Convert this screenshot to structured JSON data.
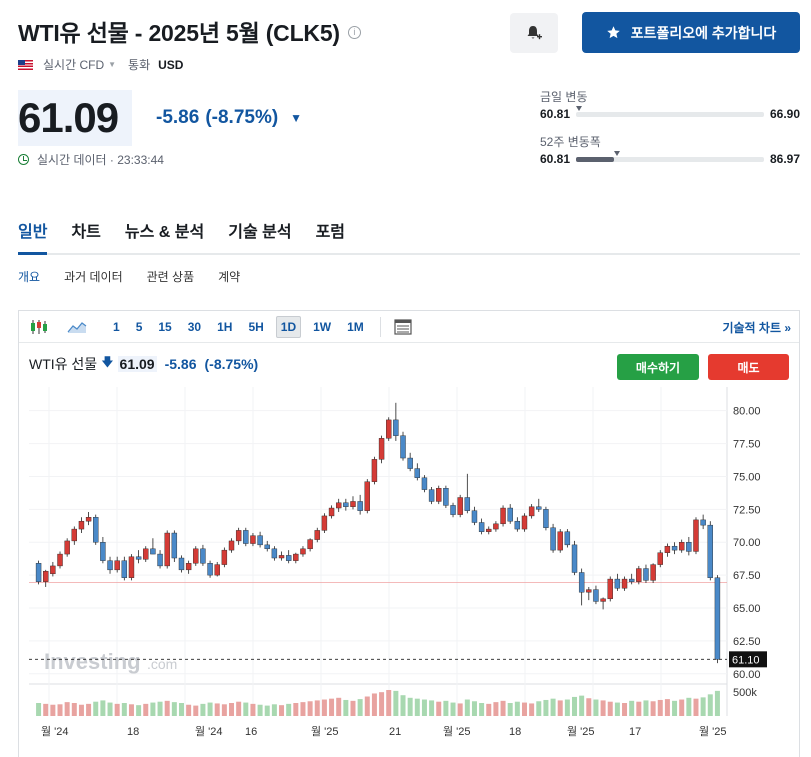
{
  "header": {
    "title": "WTI유 선물 - 2025년 5월 (CLK5)",
    "market_type": "실시간 CFD",
    "currency_label": "통화",
    "currency": "USD",
    "portfolio_label": "포트폴리오에 추가합니다"
  },
  "quote": {
    "price": "61.09",
    "change": "-5.86",
    "change_pct": "(-8.75%)",
    "realtime_label": "실시간 데이터 · 23:33:44"
  },
  "ranges": {
    "day": {
      "label": "금일 변동",
      "low": "60.81",
      "high": "66.90",
      "position": 0.0
    },
    "week52": {
      "label": "52주 변동폭",
      "low": "60.81",
      "high": "86.97",
      "position": 0.2
    }
  },
  "tabs": [
    "일반",
    "차트",
    "뉴스 & 분석",
    "기술 분석",
    "포럼"
  ],
  "subtabs": [
    "개요",
    "과거 데이터",
    "관련 상품",
    "계약"
  ],
  "toolbar": {
    "timeframes": [
      "1",
      "5",
      "15",
      "30",
      "1H",
      "5H",
      "1D",
      "1W",
      "1M"
    ],
    "active_timeframe": "1D",
    "tech_chart_label": "기술적 차트 »"
  },
  "chart_legend": {
    "name": "WTI유 선물",
    "price": "61.09",
    "change": "-5.86",
    "change_pct": "(-8.75%)"
  },
  "trade": {
    "buy": "매수하기",
    "sell": "매도"
  },
  "watermark": {
    "brand": "Investing",
    "suffix": ".com"
  },
  "colors": {
    "up": "#d43b36",
    "down": "#4a89c8",
    "accent": "#1256a0"
  },
  "chart_data": {
    "type": "candlestick",
    "y_ticks": [
      "80.00",
      "77.50",
      "75.00",
      "72.50",
      "70.00",
      "67.50",
      "65.00",
      "62.50",
      "60.00"
    ],
    "ylim": [
      59.3,
      81.8
    ],
    "last_price_label": "61.10",
    "last_price": 61.1,
    "reference_price": 66.95,
    "volume_label": "500k",
    "x_labels": [
      "월 '24",
      "18",
      "월 '24",
      "16",
      "월 '25",
      "21",
      "월 '25",
      "18",
      "월 '25",
      "17",
      "월 '25"
    ],
    "ohlc": [
      [
        68.4,
        68.6,
        66.8,
        67.0
      ],
      [
        67.0,
        67.9,
        66.6,
        67.8
      ],
      [
        67.6,
        68.5,
        67.4,
        68.2
      ],
      [
        68.2,
        69.3,
        68.0,
        69.1
      ],
      [
        69.1,
        70.3,
        68.9,
        70.1
      ],
      [
        70.1,
        71.2,
        69.8,
        71.0
      ],
      [
        71.0,
        71.9,
        70.7,
        71.6
      ],
      [
        71.6,
        72.3,
        71.3,
        71.9
      ],
      [
        71.9,
        72.1,
        69.8,
        70.0
      ],
      [
        70.0,
        70.4,
        68.4,
        68.6
      ],
      [
        68.6,
        68.9,
        67.6,
        67.9
      ],
      [
        67.9,
        68.9,
        67.7,
        68.6
      ],
      [
        68.6,
        68.9,
        67.1,
        67.3
      ],
      [
        67.3,
        69.1,
        67.1,
        68.9
      ],
      [
        68.9,
        69.4,
        68.4,
        68.7
      ],
      [
        68.7,
        69.7,
        68.5,
        69.5
      ],
      [
        69.5,
        70.3,
        69.1,
        69.1
      ],
      [
        69.1,
        69.4,
        68.0,
        68.2
      ],
      [
        68.2,
        70.9,
        68.0,
        70.7
      ],
      [
        70.7,
        70.9,
        68.5,
        68.8
      ],
      [
        68.8,
        69.0,
        67.7,
        67.9
      ],
      [
        67.9,
        68.6,
        67.6,
        68.4
      ],
      [
        68.4,
        69.7,
        68.2,
        69.5
      ],
      [
        69.5,
        69.8,
        68.2,
        68.4
      ],
      [
        68.4,
        68.6,
        67.3,
        67.5
      ],
      [
        67.5,
        68.5,
        67.4,
        68.3
      ],
      [
        68.3,
        69.6,
        68.1,
        69.4
      ],
      [
        69.4,
        70.3,
        69.2,
        70.1
      ],
      [
        70.1,
        71.1,
        69.8,
        70.9
      ],
      [
        70.9,
        71.1,
        69.7,
        69.9
      ],
      [
        69.9,
        70.7,
        69.7,
        70.5
      ],
      [
        70.5,
        70.8,
        69.6,
        69.8
      ],
      [
        69.8,
        70.1,
        69.3,
        69.5
      ],
      [
        69.5,
        69.7,
        68.6,
        68.8
      ],
      [
        68.8,
        69.3,
        68.6,
        69.0
      ],
      [
        69.0,
        69.4,
        68.4,
        68.6
      ],
      [
        68.6,
        69.2,
        68.4,
        69.1
      ],
      [
        69.1,
        69.7,
        68.9,
        69.5
      ],
      [
        69.5,
        70.3,
        69.3,
        70.2
      ],
      [
        70.2,
        71.1,
        70.0,
        70.9
      ],
      [
        70.9,
        72.2,
        70.7,
        72.0
      ],
      [
        72.0,
        72.8,
        71.8,
        72.6
      ],
      [
        72.6,
        73.3,
        72.3,
        73.0
      ],
      [
        73.0,
        73.3,
        72.4,
        72.7
      ],
      [
        72.7,
        73.5,
        72.5,
        73.1
      ],
      [
        73.1,
        73.6,
        72.1,
        72.4
      ],
      [
        72.4,
        74.8,
        72.2,
        74.6
      ],
      [
        74.6,
        76.5,
        74.4,
        76.3
      ],
      [
        76.3,
        78.1,
        76.0,
        77.9
      ],
      [
        77.9,
        79.5,
        77.7,
        79.3
      ],
      [
        79.3,
        80.6,
        77.7,
        78.1
      ],
      [
        78.1,
        78.4,
        76.2,
        76.4
      ],
      [
        76.4,
        76.8,
        75.4,
        75.6
      ],
      [
        75.6,
        76.0,
        74.7,
        74.9
      ],
      [
        74.9,
        75.1,
        73.8,
        74.0
      ],
      [
        74.0,
        74.2,
        72.9,
        73.1
      ],
      [
        73.1,
        74.3,
        72.9,
        74.1
      ],
      [
        74.1,
        74.3,
        72.6,
        72.8
      ],
      [
        72.8,
        73.0,
        71.9,
        72.1
      ],
      [
        72.1,
        73.6,
        71.9,
        73.4
      ],
      [
        73.4,
        75.2,
        72.2,
        72.4
      ],
      [
        72.4,
        72.7,
        71.3,
        71.5
      ],
      [
        71.5,
        71.8,
        70.6,
        70.8
      ],
      [
        70.8,
        71.2,
        70.6,
        71.0
      ],
      [
        71.0,
        71.6,
        70.8,
        71.4
      ],
      [
        71.4,
        72.8,
        71.2,
        72.6
      ],
      [
        72.6,
        72.9,
        71.4,
        71.6
      ],
      [
        71.6,
        71.9,
        70.8,
        71.0
      ],
      [
        71.0,
        72.2,
        70.8,
        72.0
      ],
      [
        72.0,
        72.9,
        71.8,
        72.7
      ],
      [
        72.7,
        73.3,
        72.3,
        72.5
      ],
      [
        72.5,
        72.7,
        70.9,
        71.1
      ],
      [
        71.1,
        71.4,
        69.2,
        69.4
      ],
      [
        69.4,
        71.0,
        69.2,
        70.8
      ],
      [
        70.8,
        71.0,
        69.6,
        69.8
      ],
      [
        69.8,
        70.1,
        67.5,
        67.7
      ],
      [
        67.7,
        68.0,
        65.2,
        66.2
      ],
      [
        66.2,
        66.6,
        65.6,
        66.4
      ],
      [
        66.4,
        66.7,
        65.3,
        65.5
      ],
      [
        65.5,
        65.8,
        64.9,
        65.7
      ],
      [
        65.7,
        67.4,
        65.5,
        67.2
      ],
      [
        67.2,
        67.6,
        66.3,
        66.5
      ],
      [
        66.5,
        67.4,
        66.3,
        67.2
      ],
      [
        67.2,
        67.6,
        66.8,
        67.0
      ],
      [
        67.0,
        68.2,
        66.8,
        68.0
      ],
      [
        68.0,
        68.3,
        66.9,
        67.1
      ],
      [
        67.1,
        68.4,
        66.9,
        68.3
      ],
      [
        68.3,
        69.4,
        68.1,
        69.2
      ],
      [
        69.2,
        69.9,
        68.9,
        69.7
      ],
      [
        69.7,
        70.0,
        69.1,
        69.4
      ],
      [
        69.4,
        70.2,
        69.2,
        70.0
      ],
      [
        70.0,
        70.4,
        69.0,
        69.3
      ],
      [
        69.3,
        71.9,
        69.1,
        71.7
      ],
      [
        71.7,
        72.1,
        71.0,
        71.3
      ],
      [
        71.3,
        71.6,
        67.1,
        67.3
      ],
      [
        67.3,
        67.5,
        60.81,
        61.1
      ]
    ],
    "volume": [
      30,
      28,
      26,
      27,
      32,
      30,
      26,
      28,
      33,
      36,
      31,
      28,
      30,
      27,
      25,
      28,
      31,
      33,
      35,
      32,
      30,
      26,
      24,
      28,
      31,
      29,
      27,
      30,
      33,
      31,
      28,
      26,
      24,
      27,
      25,
      28,
      30,
      32,
      34,
      36,
      38,
      40,
      42,
      37,
      35,
      39,
      45,
      52,
      55,
      60,
      58,
      48,
      42,
      40,
      38,
      36,
      33,
      35,
      31,
      29,
      38,
      34,
      30,
      28,
      32,
      35,
      30,
      33,
      31,
      29,
      34,
      37,
      40,
      36,
      38,
      44,
      47,
      41,
      38,
      36,
      33,
      31,
      30,
      35,
      33,
      36,
      34,
      37,
      39,
      35,
      38,
      42,
      40,
      43,
      50,
      58
    ]
  }
}
